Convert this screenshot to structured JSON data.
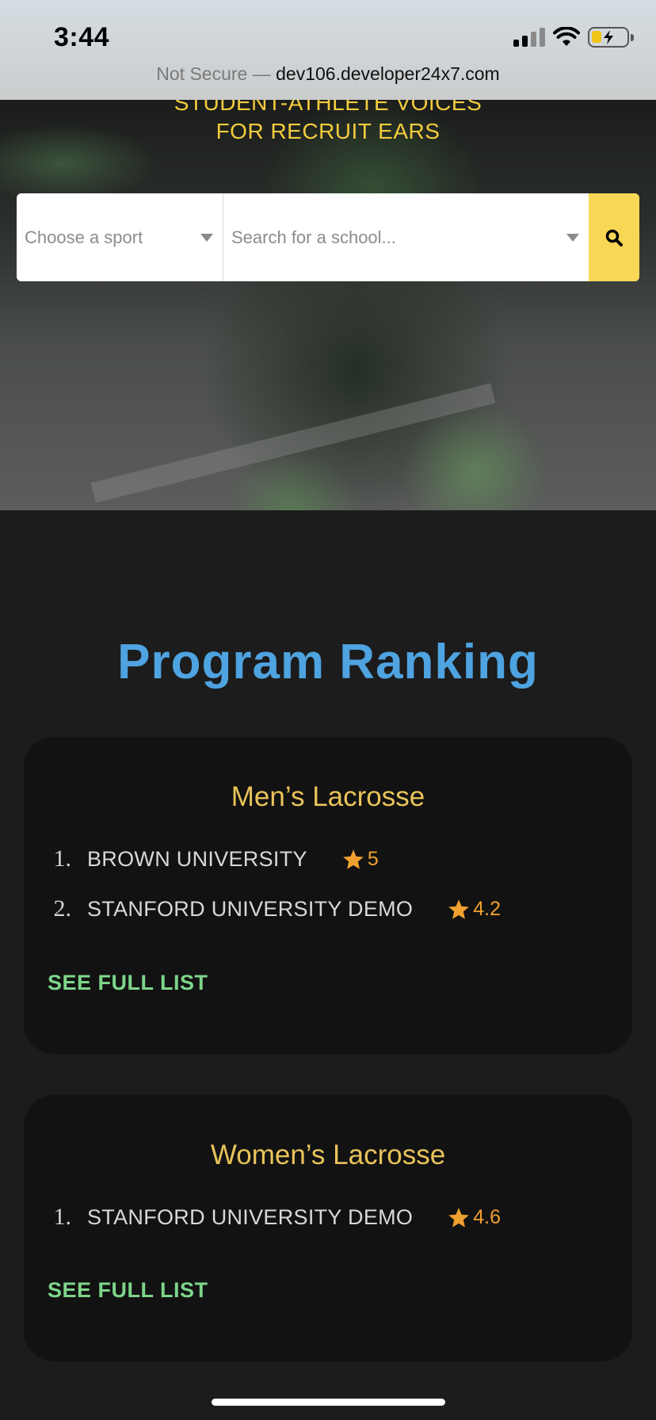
{
  "status_bar": {
    "time": "3:44"
  },
  "browser": {
    "insecure_label": "Not Secure",
    "separator": " — ",
    "host": "dev106.developer24x7.com"
  },
  "hero": {
    "tagline_line1": "STUDENT-ATHLETE VOICES",
    "tagline_line2": "FOR RECRUIT EARS"
  },
  "search": {
    "sport_placeholder": "Choose a sport",
    "school_placeholder": "Search for a school..."
  },
  "ranking": {
    "title": "Program Ranking",
    "cards": [
      {
        "title": "Men’s Lacrosse",
        "items": [
          {
            "rank": "1.",
            "name": "BROWN UNIVERSITY",
            "rating": "5"
          },
          {
            "rank": "2.",
            "name": "STANFORD UNIVERSITY DEMO",
            "rating": "4.2"
          }
        ],
        "link": "SEE FULL LIST"
      },
      {
        "title": "Women’s Lacrosse",
        "items": [
          {
            "rank": "1.",
            "name": "STANFORD UNIVERSITY DEMO",
            "rating": "4.6"
          }
        ],
        "link": "SEE FULL LIST"
      }
    ]
  },
  "colors": {
    "accent_yellow": "#f8d756",
    "title_blue": "#4ea3e0",
    "card_title": "#e9c35a",
    "link_green": "#7dd58a",
    "star": "#f0a02e"
  },
  "icons": {
    "search": "search-icon",
    "star": "star-icon",
    "caret": "chevron-down-icon"
  }
}
